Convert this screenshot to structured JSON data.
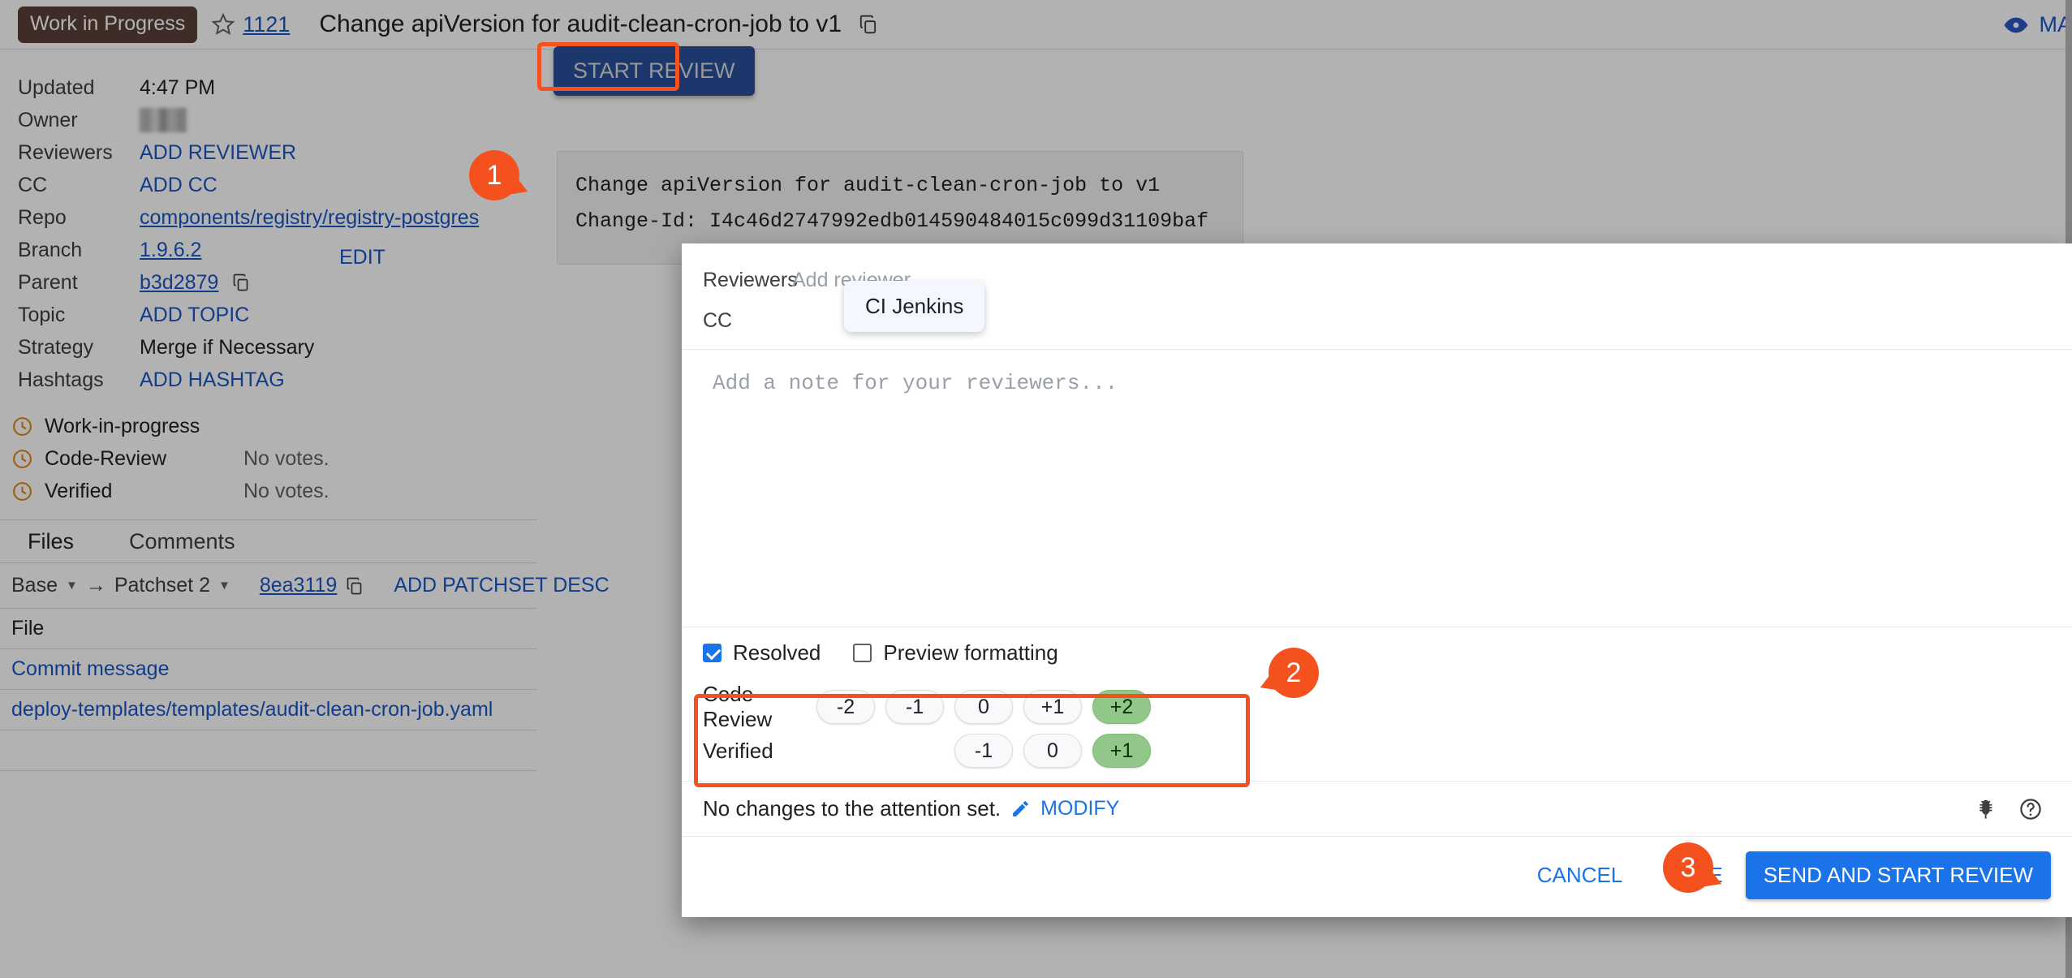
{
  "header": {
    "wip_badge": "Work in Progress",
    "star_icon": "star-outline-icon",
    "change_number": "1121",
    "title": "Change apiVersion for audit-clean-cron-job to v1",
    "copy_icon": "copy-icon",
    "eye_icon": "eye-icon",
    "mark_reviewed": "MA"
  },
  "metadata": {
    "rows": [
      {
        "label": "Updated",
        "value": "4:47 PM",
        "kind": "text"
      },
      {
        "label": "Owner",
        "value": "",
        "kind": "redacted"
      },
      {
        "label": "Reviewers",
        "value": "ADD REVIEWER",
        "kind": "action"
      },
      {
        "label": "CC",
        "value": "ADD CC",
        "kind": "action"
      },
      {
        "label": "Repo",
        "value": "components/registry/registry-postgres",
        "kind": "link-underline"
      },
      {
        "label": "Branch",
        "value": "1.9.6.2",
        "kind": "link-underline"
      },
      {
        "label": "Parent",
        "value": "b3d2879",
        "kind": "link-copy"
      },
      {
        "label": "Topic",
        "value": "ADD TOPIC",
        "kind": "action"
      },
      {
        "label": "Strategy",
        "value": "Merge if Necessary",
        "kind": "text"
      },
      {
        "label": "Hashtags",
        "value": "ADD HASHTAG",
        "kind": "action"
      }
    ],
    "edit_label": "EDIT"
  },
  "label_status": {
    "rows": [
      {
        "icon": "clock-icon",
        "name": "Work-in-progress",
        "value": ""
      },
      {
        "icon": "clock-icon",
        "name": "Code-Review",
        "value": "No votes."
      },
      {
        "icon": "clock-icon",
        "name": "Verified",
        "value": "No votes."
      }
    ]
  },
  "files_panel": {
    "tabs": [
      "Files",
      "Comments"
    ],
    "patch_range": {
      "base": "Base",
      "arrow": "→",
      "patchset": "Patchset 2",
      "commit_sha": "8ea3119",
      "copy_icon": "copy-icon",
      "add_description": "ADD PATCHSET DESC"
    },
    "column_header": "File",
    "files": [
      "Commit message",
      "deploy-templates/templates/audit-clean-cron-job.yaml"
    ]
  },
  "commit_box": {
    "subject": "Change apiVersion for audit-clean-cron-job to v1",
    "change_id": "Change-Id: I4c46d2747992edb014590484015c099d31109baf"
  },
  "start_review_button": {
    "label": "START REVIEW"
  },
  "reply_dialog": {
    "reviewers": {
      "label": "Reviewers",
      "placeholder": "Add reviewer..."
    },
    "cc": {
      "label": "CC",
      "placeholder": ""
    },
    "suggestion": "CI Jenkins",
    "note_placeholder": "Add a note for your reviewers...",
    "checkboxes": [
      {
        "label": "Resolved",
        "checked": true
      },
      {
        "label": "Preview formatting",
        "checked": false
      }
    ],
    "labels": [
      {
        "name": "Code-Review",
        "indent": 0,
        "options": [
          "-2",
          "-1",
          "0",
          "+1",
          "+2"
        ],
        "selected": "+2"
      },
      {
        "name": "Verified",
        "indent": 2,
        "options": [
          "-1",
          "0",
          "+1"
        ],
        "selected": "+1"
      }
    ],
    "attention": {
      "text": "No changes to the attention set.",
      "pencil_icon": "pencil-icon",
      "modify_label": "MODIFY",
      "bug_icon": "bug-icon",
      "help_icon": "help-circle-icon"
    },
    "footer": {
      "cancel": "CANCEL",
      "save": "SAVE",
      "send": "SEND AND START REVIEW"
    }
  },
  "annotations": {
    "badges": [
      "1",
      "2",
      "3"
    ],
    "accent_color": "#f4511e"
  },
  "colors": {
    "link": "#1a56c4",
    "primary_button": "#1a73e8",
    "start_review_button": "#27509b",
    "vote_selected": "#91c788",
    "wip_badge": "#5a4038",
    "clock_icon": "#e08b1f",
    "annotation": "#f4511e"
  }
}
